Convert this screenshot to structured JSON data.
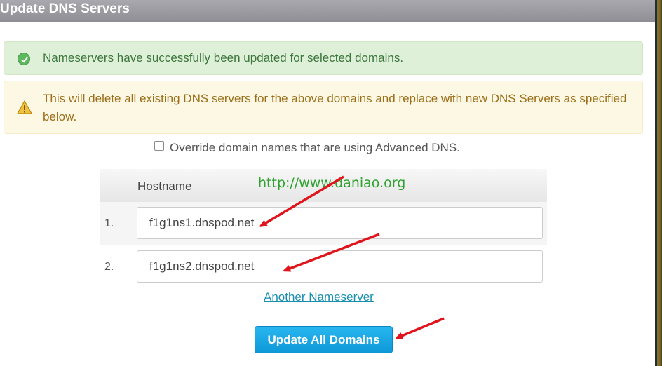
{
  "dialog": {
    "title": "Update DNS Servers"
  },
  "alerts": {
    "success": "Nameservers have successfully been updated for selected domains.",
    "warning": "This will delete all existing DNS servers for the above domains and replace with new DNS Servers as specified below."
  },
  "override_label": "Override domain names that are using Advanced DNS.",
  "table": {
    "header": "Hostname",
    "rows": [
      {
        "num": "1.",
        "value": "f1g1ns1.dnspod.net"
      },
      {
        "num": "2.",
        "value": "f1g1ns2.dnspod.net"
      }
    ]
  },
  "another_link": "Another Nameserver",
  "submit_label": "Update All Domains",
  "watermark": "http://www.daniao.org",
  "colors": {
    "success_bg": "#dff0d8",
    "warning_bg": "#fcf8e3",
    "button": "#17a7e6",
    "annotation_arrow": "#e0141c"
  }
}
